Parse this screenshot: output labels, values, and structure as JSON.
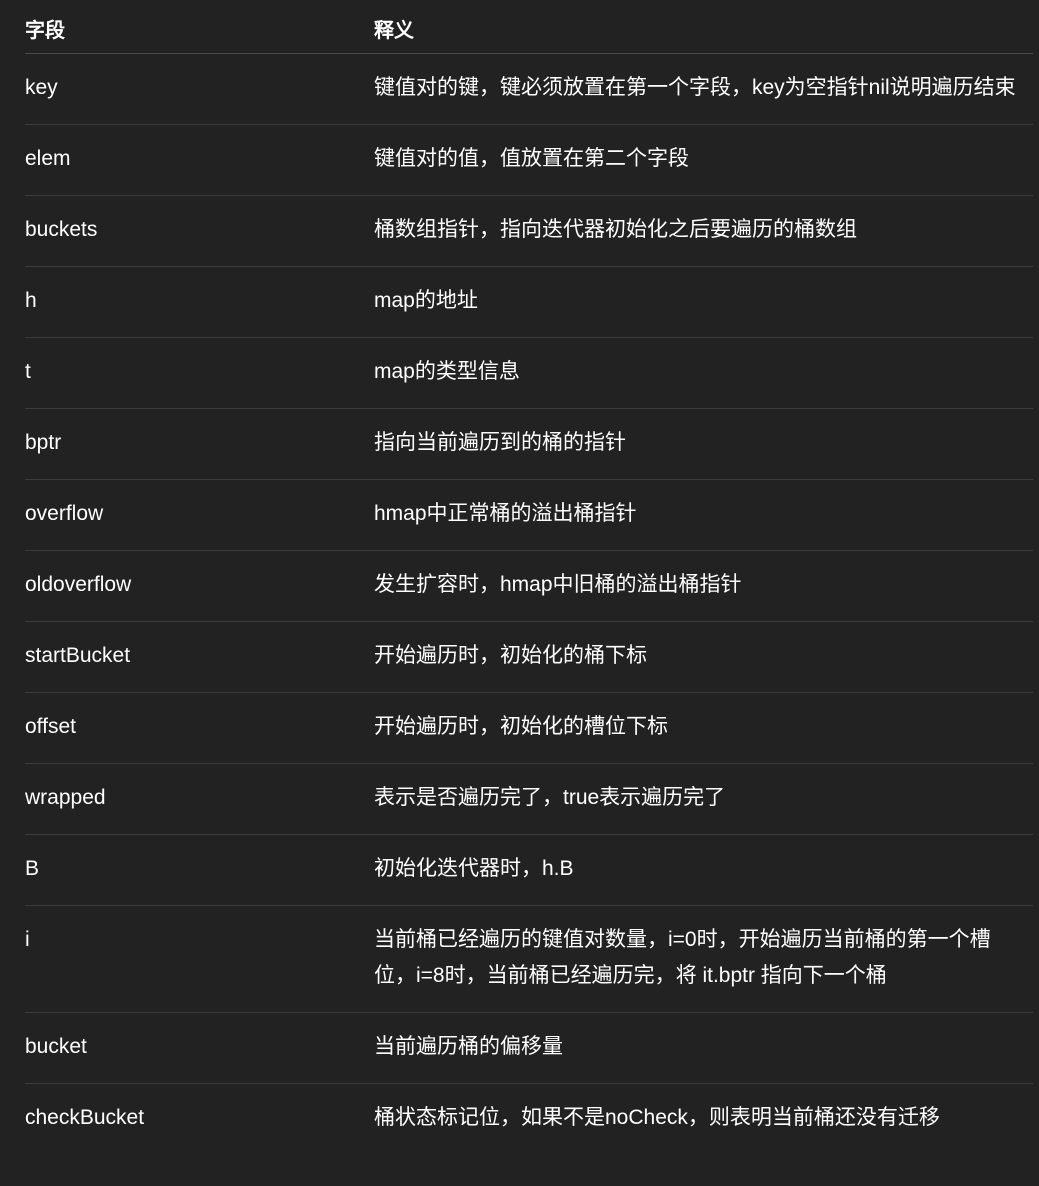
{
  "table": {
    "headers": [
      "字段",
      "释义"
    ],
    "rows": [
      {
        "field": "key",
        "desc": "键值对的键，键必须放置在第一个字段，key为空指针nil说明遍历结束"
      },
      {
        "field": "elem",
        "desc": "键值对的值，值放置在第二个字段"
      },
      {
        "field": "buckets",
        "desc": "桶数组指针，指向迭代器初始化之后要遍历的桶数组"
      },
      {
        "field": "h",
        "desc": "map的地址"
      },
      {
        "field": "t",
        "desc": "map的类型信息"
      },
      {
        "field": "bptr",
        "desc": "指向当前遍历到的桶的指针"
      },
      {
        "field": "overflow",
        "desc": "hmap中正常桶的溢出桶指针"
      },
      {
        "field": "oldoverflow",
        "desc": "发生扩容时，hmap中旧桶的溢出桶指针"
      },
      {
        "field": "startBucket",
        "desc": "开始遍历时，初始化的桶下标"
      },
      {
        "field": "offset",
        "desc": "开始遍历时，初始化的槽位下标"
      },
      {
        "field": "wrapped",
        "desc": "表示是否遍历完了，true表示遍历完了"
      },
      {
        "field": "B",
        "desc": "初始化迭代器时，h.B"
      },
      {
        "field": "i",
        "desc": "当前桶已经遍历的键值对数量，i=0时，开始遍历当前桶的第一个槽位，i=8时，当前桶已经遍历完，将 it.bptr 指向下一个桶"
      },
      {
        "field": "bucket",
        "desc": "当前遍历桶的偏移量"
      },
      {
        "field": "checkBucket",
        "desc": "桶状态标记位，如果不是noCheck，则表明当前桶还没有迁移"
      }
    ]
  }
}
